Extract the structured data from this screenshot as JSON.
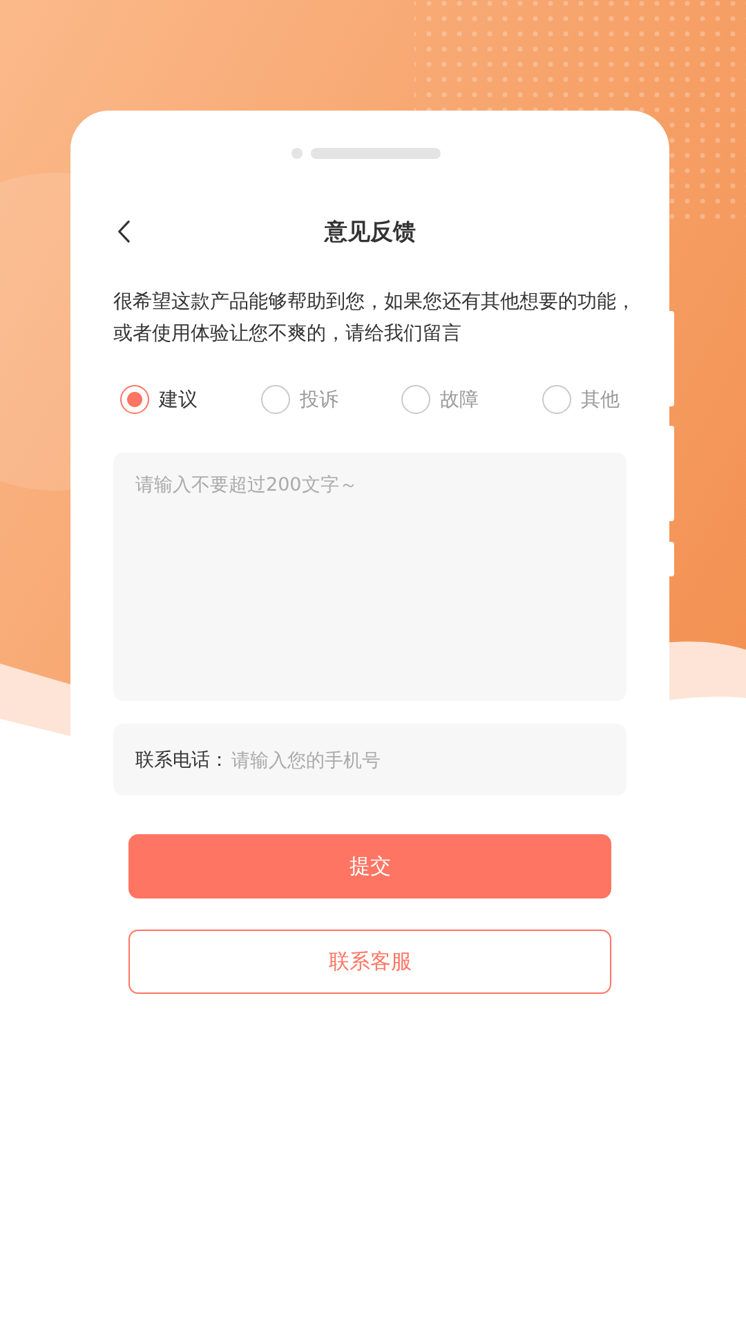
{
  "header": {
    "title": "意见反馈"
  },
  "intro": "很希望这款产品能够帮助到您，如果您还有其他想要的功能，或者使用体验让您不爽的，请给我们留言",
  "categories": [
    {
      "label": "建议",
      "selected": true
    },
    {
      "label": "投诉",
      "selected": false
    },
    {
      "label": "故障",
      "selected": false
    },
    {
      "label": "其他",
      "selected": false
    }
  ],
  "feedback": {
    "placeholder": "请输入不要超过200文字～"
  },
  "phone": {
    "label": "联系电话：",
    "placeholder": "请输入您的手机号"
  },
  "buttons": [
    {
      "label": "提交",
      "kind": "primary"
    },
    {
      "label": "联系客服",
      "kind": "outline"
    }
  ]
}
